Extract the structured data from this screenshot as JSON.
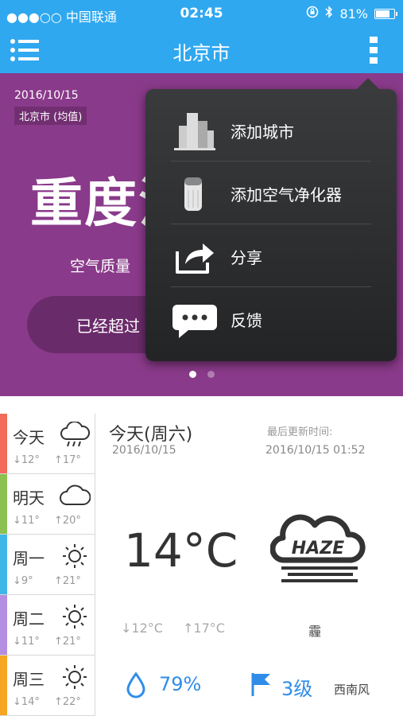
{
  "status_bar": {
    "carrier": "●●●○○ 中国联通",
    "time": "02:45",
    "battery": "81%",
    "battery_level": 0.81
  },
  "nav": {
    "title": "北京市"
  },
  "aqi": {
    "date": "2016/10/15",
    "location": "北京市 (均值)",
    "level_text": "重度污",
    "quality_text": "空气质量",
    "pill_text": "已经超过",
    "page_index": 0,
    "page_count": 2,
    "bg_color": "#8a3a8a"
  },
  "menu": {
    "items": [
      {
        "label": "添加城市",
        "icon": "city-buildings-icon"
      },
      {
        "label": "添加空气净化器",
        "icon": "air-purifier-icon"
      },
      {
        "label": "分享",
        "icon": "share-icon"
      },
      {
        "label": "反馈",
        "icon": "feedback-chat-icon"
      }
    ]
  },
  "forecast": [
    {
      "name": "今天",
      "low": "↓12°",
      "high": "↑17°",
      "icon": "rain-cloud-icon",
      "color": "#f26b5b"
    },
    {
      "name": "明天",
      "low": "↓11°",
      "high": "↑20°",
      "icon": "cloud-icon",
      "color": "#8cc152"
    },
    {
      "name": "周一",
      "low": "↓9°",
      "high": "↑21°",
      "icon": "sun-icon",
      "color": "#3fb6e8"
    },
    {
      "name": "周二",
      "low": "↓11°",
      "high": "↑21°",
      "icon": "sun-icon",
      "color": "#b48ee0"
    },
    {
      "name": "周三",
      "low": "↓14°",
      "high": "↑22°",
      "icon": "sun-icon",
      "color": "#f5a623"
    }
  ],
  "today": {
    "title": "今天(周六)",
    "date": "2016/10/15",
    "updated_label": "最后更新时间:",
    "updated_time": "2016/10/15 01:52",
    "temperature": "14°C",
    "low": "↓12°C",
    "high": "↑17°C",
    "condition": "霾",
    "haze_label": "HAZE",
    "humidity": "79%",
    "wind_level": "3级",
    "wind_direction": "西南风"
  }
}
